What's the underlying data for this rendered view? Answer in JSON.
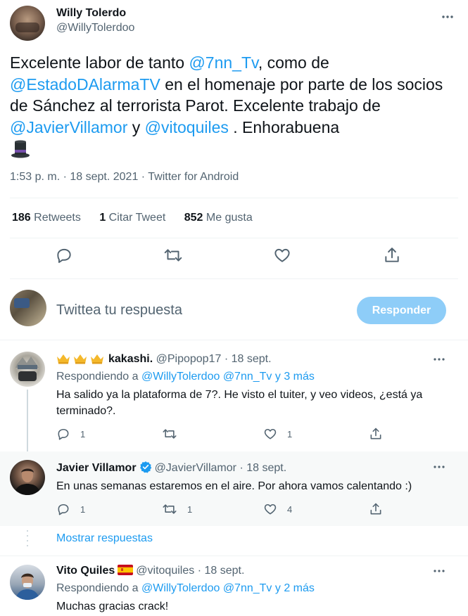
{
  "main_tweet": {
    "author_name": "Willy Tolerdo",
    "author_handle": "@WillyTolerdoo",
    "text": {
      "t1": "Excelente labor de tanto ",
      "m1": "@7nn_Tv",
      "t2": ", como de ",
      "m2": "@EstadoDAlarmaTV",
      "t3": " en el homenaje por parte de los socios de Sánchez al terrorista Parot. Excelente trabajo de ",
      "m3": "@JavierVillamor",
      "t4": " y ",
      "m4": "@vitoquiles",
      "t5": " . Enhorabuena"
    },
    "emoji": "top-hat",
    "timestamp": "1:53 p. m. · 18 sept. 2021 · Twitter for Android",
    "stats": {
      "retweets_count": "186",
      "retweets_label": "Retweets",
      "quotes_count": "1",
      "quotes_label": "Citar Tweet",
      "likes_count": "852",
      "likes_label": "Me gusta"
    },
    "actions": [
      "reply-icon",
      "retweet-icon",
      "like-icon",
      "share-icon"
    ]
  },
  "composer": {
    "placeholder": "Twittea tu respuesta",
    "button_label": "Responder"
  },
  "replies": [
    {
      "name": "kakashi.",
      "prefix_emoji": "crown-icon x3",
      "handle": "@Pipopop17",
      "date": "· 18 sept.",
      "replying_label": "Respondiendo a ",
      "replying_handles": "@WillyTolerdoo @7nn_Tv y 3 más",
      "text": "Ha salido ya la plataforma de 7?. He visto el tuiter, y veo videos, ¿está ya terminado?.",
      "reply_count": "1",
      "retweet_count": "",
      "like_count": "1"
    },
    {
      "name": "Javier Villamor",
      "verified": true,
      "handle": "@JavierVillamor",
      "date": "· 18 sept.",
      "text": "En unas semanas estaremos en el aire. Por ahora vamos calentando :)",
      "reply_count": "1",
      "retweet_count": "1",
      "like_count": "4"
    },
    {
      "name": "Vito Quiles",
      "flag_emoji": "spain-flag",
      "handle": "@vitoquiles",
      "date": "· 18 sept.",
      "replying_label": "Respondiendo a ",
      "replying_handles": "@WillyTolerdoo @7nn_Tv y 2 más",
      "text": "Muchas gracias crack!"
    }
  ],
  "show_replies_label": "Mostrar respuestas",
  "colors": {
    "link": "#1d9bf0",
    "muted": "#536471",
    "button_disabled": "#8ecdf8",
    "verified": "#1d9bf0"
  }
}
